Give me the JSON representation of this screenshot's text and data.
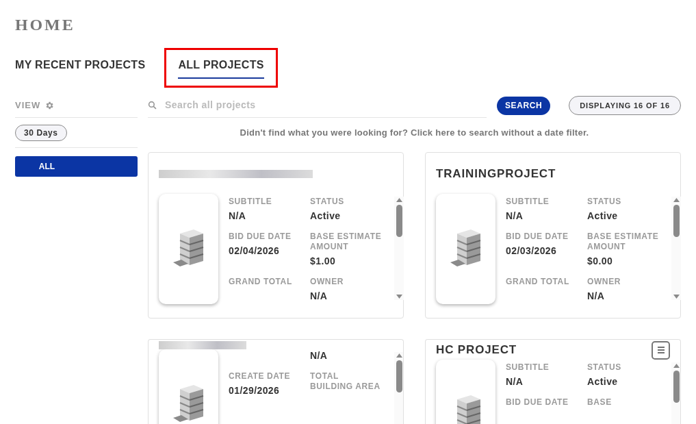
{
  "page_title": "HOME",
  "tabs": [
    {
      "label": "MY RECENT PROJECTS",
      "selected": false,
      "highlighted": false
    },
    {
      "label": "ALL PROJECTS",
      "selected": true,
      "highlighted": true
    }
  ],
  "sidebar": {
    "view_label": "VIEW",
    "chip": "30 Days",
    "filters": [
      {
        "label": "ALL",
        "selected": true
      }
    ]
  },
  "search": {
    "placeholder": "Search all projects",
    "button": "SEARCH",
    "count": "DISPLAYING 16 OF 16"
  },
  "hint": "Didn't find what you were looking for? Click here to search without a date filter.",
  "projects": [
    {
      "title_redacted": true,
      "menu": false,
      "rows": [
        [
          {
            "label": "SUBTITLE",
            "value": "N/A"
          },
          {
            "label": "STATUS",
            "value": "Active"
          }
        ],
        [
          {
            "label": "BID DUE DATE",
            "value": "02/04/2026"
          },
          {
            "label": "BASE ESTIMATE AMOUNT",
            "value": "$1.00"
          }
        ],
        [
          {
            "label": "GRAND TOTAL"
          },
          {
            "label": "OWNER",
            "value": "N/A"
          }
        ]
      ]
    },
    {
      "title": "TRAININGPROJECT",
      "title_redacted": false,
      "menu": false,
      "rows": [
        [
          {
            "label": "SUBTITLE",
            "value": "N/A"
          },
          {
            "label": "STATUS",
            "value": "Active"
          }
        ],
        [
          {
            "label": "BID DUE DATE",
            "value": "02/03/2026"
          },
          {
            "label": "BASE ESTIMATE AMOUNT",
            "value": "$0.00"
          }
        ],
        [
          {
            "label": "GRAND TOTAL"
          },
          {
            "label": "OWNER",
            "value": "N/A"
          }
        ]
      ]
    },
    {
      "title_redacted": true,
      "menu": false,
      "rows": [
        [
          {},
          {
            "value": "N/A"
          }
        ],
        [
          {
            "label": "CREATE DATE",
            "value": "01/29/2026"
          },
          {
            "label": "TOTAL BUILDING AREA"
          }
        ]
      ]
    },
    {
      "title": "HC PROJECT",
      "title_redacted": false,
      "menu": true,
      "rows": [
        [
          {
            "label": "SUBTITLE",
            "value": "N/A"
          },
          {
            "label": "STATUS",
            "value": "Active"
          }
        ],
        [
          {
            "label": "BID DUE DATE"
          },
          {
            "label": "BASE"
          }
        ]
      ]
    }
  ]
}
